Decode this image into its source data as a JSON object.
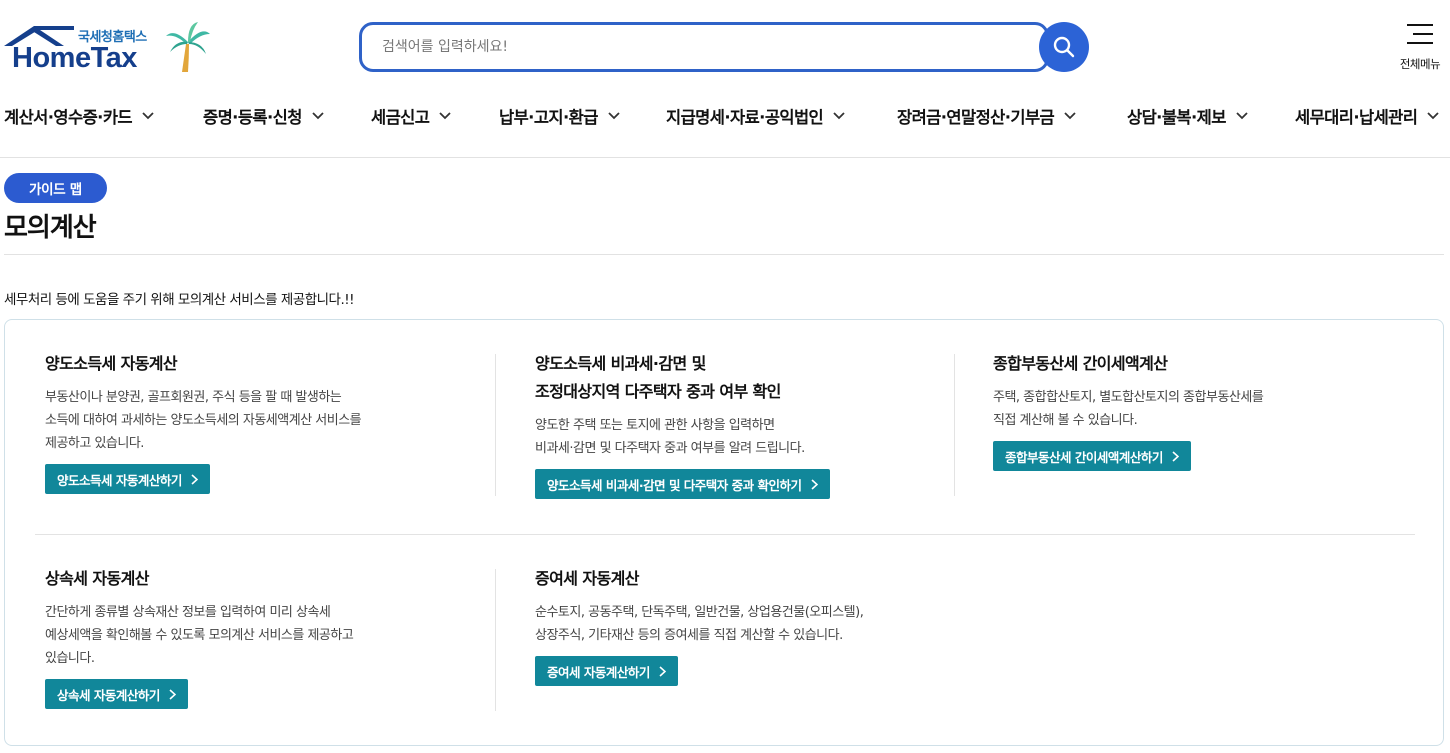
{
  "header": {
    "logo_sub": "국세청홈택스",
    "logo_name": "HomeTax",
    "search_placeholder": "검색어를 입력하세요!",
    "all_menu_label": "전체메뉴"
  },
  "gnb": [
    "계산서·영수증·카드",
    "증명·등록·신청",
    "세금신고",
    "납부·고지·환급",
    "지급명세·자료·공익법인",
    "장려금·연말정산·기부금",
    "상담·불복·제보",
    "세무대리·납세관리"
  ],
  "page": {
    "badge": "가이드 맵",
    "title": "모의계산",
    "intro": "세무처리 등에 도움을 주기 위해 모의계산 서비스를 제공합니다.!!"
  },
  "services": [
    {
      "title_lines": [
        "양도소득세 자동계산"
      ],
      "desc_lines": [
        "부동산이나 분양권, 골프회원권, 주식 등을 팔 때 발생하는",
        "소득에 대하여 과세하는 양도소득세의 자동세액계산 서비스를",
        "제공하고 있습니다."
      ],
      "button": "양도소득세 자동계산하기"
    },
    {
      "title_lines": [
        "양도소득세 비과세·감면 및",
        "조정대상지역 다주택자 중과 여부 확인"
      ],
      "desc_lines": [
        "양도한 주택 또는 토지에 관한 사항을 입력하면",
        "비과세·감면 및 다주택자 중과 여부를 알려 드립니다."
      ],
      "button": "양도소득세 비과세·감면 및 다주택자 중과 확인하기"
    },
    {
      "title_lines": [
        "종합부동산세 간이세액계산"
      ],
      "desc_lines": [
        "주택, 종합합산토지, 별도합산토지의 종합부동산세를",
        "직접 계산해 볼 수 있습니다."
      ],
      "button": "종합부동산세 간이세액계산하기"
    },
    {
      "title_lines": [
        "상속세 자동계산"
      ],
      "desc_lines": [
        "간단하게 종류별 상속재산 정보를 입력하여 미리 상속세",
        "예상세액을 확인해볼 수 있도록 모의계산 서비스를 제공하고",
        "있습니다."
      ],
      "button": "상속세 자동계산하기"
    },
    {
      "title_lines": [
        "증여세 자동계산"
      ],
      "desc_lines": [
        "순수토지, 공동주택, 단독주택, 일반건물, 상업용건물(오피스텔),",
        "상장주식, 기타재산 등의 증여세를 직접 계산할 수 있습니다."
      ],
      "button": "증여세 자동계산하기"
    }
  ],
  "colors": {
    "brand_blue": "#2c5bd0",
    "button_teal": "#11879a",
    "logo_navy": "#153f8c"
  }
}
